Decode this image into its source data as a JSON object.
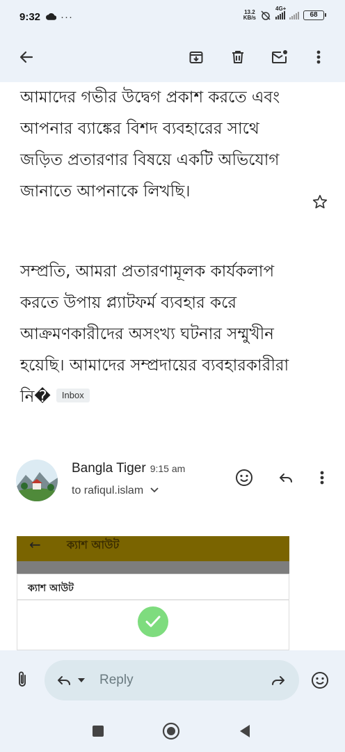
{
  "status_bar": {
    "time": "9:32",
    "dots": "···",
    "net_speed_value": "13.2",
    "net_speed_unit": "KB/s",
    "network": "4G+",
    "battery": "68"
  },
  "toolbar": {
    "icons": [
      "back-arrow-icon",
      "archive-icon",
      "delete-icon",
      "mark-unread-icon",
      "more-vert-icon"
    ]
  },
  "email": {
    "para1": "আমাদের গভীর উদ্বেগ প্রকাশ করতে এবং আপনার ব্যাঙ্কের বিশদ ব্যবহারের সাথে জড়িত প্রতারণার বিষয়ে একটি অভিযোগ জানাতে আপনাকে লিখছি।",
    "para2": "সম্প্রতি, আমরা প্রতারণামূলক কার্যকলাপ করতে উপায় প্ল্যাটফর্ম ব্যবহার করে আক্রমণকারীদের অসংখ্য ঘটনার সম্মুখীন হয়েছি। আমাদের সম্প্রদায়ের ব্যবহারকারীরা নি�",
    "label_chip": "Inbox"
  },
  "sender": {
    "name": "Bangla Tiger",
    "time": "9:15 am",
    "to": "to rafiqul.islam"
  },
  "attachment": {
    "header_title": "ক্যাশ আউট",
    "card_title": "ক্যাশ আউট"
  },
  "reply_bar": {
    "placeholder": "Reply"
  },
  "colors": {
    "background": "#ecf2f9",
    "reply_pill": "#dce8ee",
    "check_green": "#7edc7e",
    "shot_header": "#7a6400"
  }
}
